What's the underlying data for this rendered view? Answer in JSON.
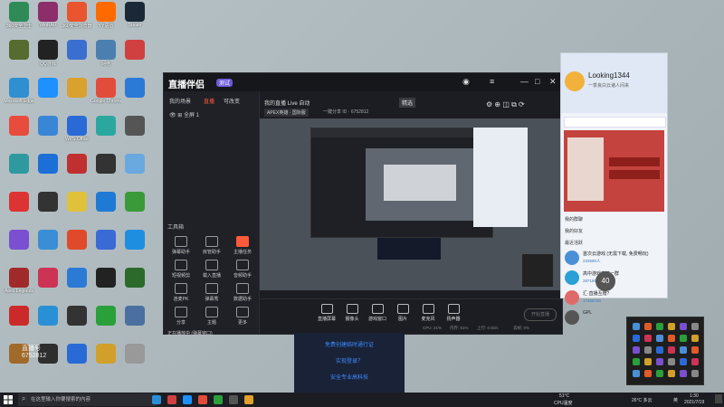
{
  "desktop_icons": [
    {
      "label": "360安全卫士",
      "color": "#2e8b57"
    },
    {
      "label": "WinRAR",
      "color": "#8b2e6a"
    },
    {
      "label": "360安全浏览器",
      "color": "#e8552e"
    },
    {
      "label": "YY语音",
      "color": "#ff6a00"
    },
    {
      "label": "Steam",
      "color": "#1b2838"
    },
    {
      "label": "",
      "color": "#556b2f"
    },
    {
      "label": "QQ游戏",
      "color": "#222"
    },
    {
      "label": "",
      "color": "#3a6fd0"
    },
    {
      "label": "网络",
      "color": "#4a7fb0"
    },
    {
      "label": "",
      "color": "#d04040"
    },
    {
      "label": "Microsoft Edge",
      "color": "#2f8fd0"
    },
    {
      "label": "",
      "color": "#1e90ff"
    },
    {
      "label": "",
      "color": "#d9a12e"
    },
    {
      "label": "Google Chrome",
      "color": "#e24c3a"
    },
    {
      "label": "",
      "color": "#2a7ad6"
    },
    {
      "label": "",
      "color": "#e84c3d"
    },
    {
      "label": "",
      "color": "#3a86d6"
    },
    {
      "label": "WPS Office",
      "color": "#2a6ad6"
    },
    {
      "label": "",
      "color": "#2aa8a0"
    },
    {
      "label": "",
      "color": "#555"
    },
    {
      "label": "",
      "color": "#2e9aa0"
    },
    {
      "label": "",
      "color": "#1c6fd6"
    },
    {
      "label": "",
      "color": "#c03030"
    },
    {
      "label": "",
      "color": "#333"
    },
    {
      "label": "",
      "color": "#6aa8e0"
    },
    {
      "label": "",
      "color": "#d33"
    },
    {
      "label": "",
      "color": "#333"
    },
    {
      "label": "",
      "color": "#e0c23a"
    },
    {
      "label": "",
      "color": "#1f7ad6"
    },
    {
      "label": "",
      "color": "#3a9a3a"
    },
    {
      "label": "",
      "color": "#7a4fd0"
    },
    {
      "label": "",
      "color": "#3a8ed6"
    },
    {
      "label": "",
      "color": "#e04a2a"
    },
    {
      "label": "",
      "color": "#3a6ad6"
    },
    {
      "label": "",
      "color": "#1e8fe0"
    },
    {
      "label": "Apex Legends",
      "color": "#a02a2a"
    },
    {
      "label": "",
      "color": "#cc3355"
    },
    {
      "label": "",
      "color": "#2a7ad6"
    },
    {
      "label": "",
      "color": "#222"
    },
    {
      "label": "",
      "color": "#2c6a2c"
    },
    {
      "label": "",
      "color": "#cc2a2a"
    },
    {
      "label": "",
      "color": "#2a90d6"
    },
    {
      "label": "",
      "color": "#333"
    },
    {
      "label": "",
      "color": "#2aa03a"
    },
    {
      "label": "",
      "color": "#4b6fa0"
    },
    {
      "label": "",
      "color": "#a06a2a"
    },
    {
      "label": "",
      "color": "#2e2e2e"
    },
    {
      "label": "",
      "color": "#2a6ad6"
    },
    {
      "label": "",
      "color": "#d0a02a"
    },
    {
      "label": "",
      "color": "#999"
    }
  ],
  "watermark": {
    "line1": "直播号",
    "line2": "6752812"
  },
  "app": {
    "logo": "直播伴侣",
    "beta": "测试",
    "side_tabs": [
      "我的场景",
      "直播",
      "可改变"
    ],
    "scene": "全屏 1",
    "tools_label": "工具箱",
    "tools": [
      {
        "label": "弹幕助手"
      },
      {
        "label": "房管助手"
      },
      {
        "label": "主播任务",
        "hot": true
      },
      {
        "label": "短视频剪"
      },
      {
        "label": "载入直播"
      },
      {
        "label": "音频助手"
      },
      {
        "label": "连麦PK"
      },
      {
        "label": "弹幕秀"
      },
      {
        "label": "数据助手"
      },
      {
        "label": "分享"
      },
      {
        "label": "主题"
      },
      {
        "label": "更多"
      }
    ],
    "notice": "正在播放中 (弹幕窗口)",
    "top_title": "我的直播 Live 自动",
    "top_tag": "精选",
    "game_tag": "APEX英雄 · 国际服",
    "room_id": "一键分享 ID · 6752812",
    "bottom_buttons": [
      "直播屏幕",
      "摄像头",
      "游戏窗口",
      "图片",
      "麦克风",
      "扬声器"
    ],
    "start_label": "开始直播",
    "status": [
      "CPU: 21%",
      "内存: 61%",
      "上行: 0 kb/s",
      "丢帧: 0%"
    ]
  },
  "qq": {
    "name": "Looking1344",
    "sign": "一季良白云诸人间来",
    "sections": [
      "我的群聊",
      "我的好友",
      "最近活跃"
    ],
    "items": [
      {
        "name": "首次云游戏 (无需下载, 免费畅玩)",
        "sub": "233580人",
        "color": "#4a90d6"
      },
      {
        "name": "高中游戏交流一群",
        "sub": "28718666",
        "color": "#2aa0d6"
      },
      {
        "name": "汇·直播互赠？",
        "sub": "17456750",
        "color": "#e06a6a"
      },
      {
        "name": "GPL",
        "sub": "",
        "color": "#555"
      }
    ]
  },
  "center_overlay": {
    "lines": [
      "免费创建临时通行证",
      "实现登录？",
      "安全专业高科技"
    ]
  },
  "float_badge": "40",
  "taskbar": {
    "search_placeholder": "在这里输入你要搜索的内容",
    "weather_temp": "51°C",
    "weather_label": "CPU温度",
    "temp": "26°C 多云",
    "time": "1:30",
    "date": "2021/7/19",
    "lang": "英"
  }
}
